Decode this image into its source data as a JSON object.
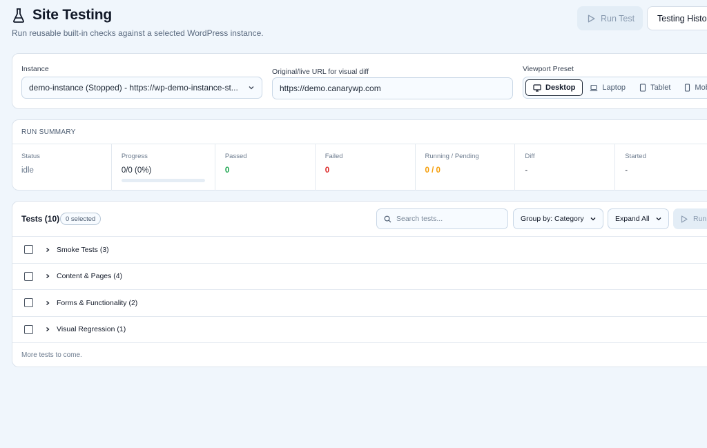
{
  "header": {
    "title": "Site Testing",
    "subtitle": "Run reusable built-in checks against a selected WordPress instance.",
    "title_icon": "flask-icon",
    "run_test_label": "Run Test",
    "history_label": "Testing History"
  },
  "config": {
    "instance_label": "Instance",
    "instance_value": "demo-instance (Stopped) - https://wp-demo-instance-st...",
    "url_label": "Original/live URL for visual diff",
    "url_value": "https://demo.canarywp.com",
    "viewport_label": "Viewport Preset",
    "viewports": [
      {
        "label": "Desktop",
        "icon": "monitor-icon",
        "active": true
      },
      {
        "label": "Laptop",
        "icon": "laptop-icon",
        "active": false
      },
      {
        "label": "Tablet",
        "icon": "tablet-icon",
        "active": false
      },
      {
        "label": "Mobile",
        "icon": "phone-icon",
        "active": false
      }
    ]
  },
  "summary": {
    "heading": "RUN SUMMARY",
    "status_label": "Status",
    "status_value": "idle",
    "progress_label": "Progress",
    "progress_value": "0/0 (0%)",
    "progress_fraction": 0,
    "passed_label": "Passed",
    "passed_value": "0",
    "failed_label": "Failed",
    "failed_value": "0",
    "running_label": "Running / Pending",
    "running_value": "0 / 0",
    "diff_label": "Diff",
    "diff_value": "-",
    "started_label": "Started",
    "started_value": "-"
  },
  "tests": {
    "title": "Tests (10)",
    "selected_badge": "0 selected",
    "search_placeholder": "Search tests...",
    "group_by_label": "Group by: Category",
    "expand_label": "Expand All",
    "run_label": "Run Selected",
    "groups": [
      {
        "label": "Smoke Tests (3)"
      },
      {
        "label": "Content & Pages (4)"
      },
      {
        "label": "Forms & Functionality (2)"
      },
      {
        "label": "Visual Regression (1)"
      }
    ],
    "footer": "More tests to come."
  },
  "colors": {
    "background": "#f0f6fc",
    "passed": "#16a34a",
    "failed": "#dc2626",
    "pending": "#f59e0b"
  }
}
